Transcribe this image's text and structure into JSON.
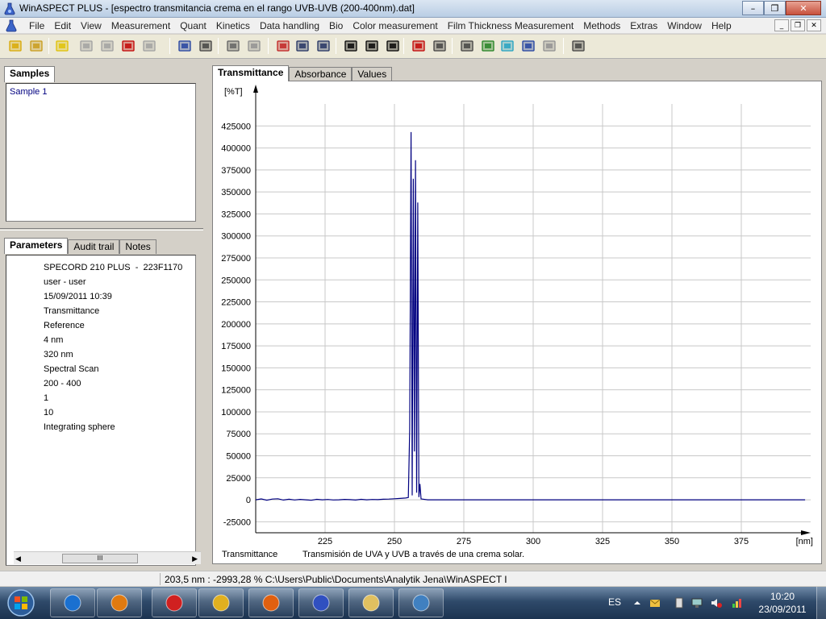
{
  "window": {
    "title": "WinASPECT PLUS - [espectro transmitancia crema en el rango UVB-UVB (200-400nm).dat]",
    "minimize": "–",
    "maximize": "❐",
    "close": "✕"
  },
  "menu": [
    "File",
    "Edit",
    "View",
    "Measurement",
    "Quant",
    "Kinetics",
    "Data handling",
    "Bio",
    "Color measurement",
    "Film Thickness Measurement",
    "Methods",
    "Extras",
    "Window",
    "Help"
  ],
  "mdi_buttons": [
    "_",
    "❐",
    "✕"
  ],
  "toolbar": [
    {
      "name": "open-icon",
      "color": "#d8a800"
    },
    {
      "name": "database-icon",
      "color": "#c89a18"
    },
    {
      "name": "palette-icon",
      "color": "#e0c000"
    },
    {
      "name": "camera-icon",
      "color": "#a0a0a0"
    },
    {
      "name": "camera-settings-icon",
      "color": "#a0a0a0"
    },
    {
      "name": "record-icon",
      "color": "#c00000"
    },
    {
      "name": "refresh-disabled-icon",
      "color": "#a0a0a0"
    },
    {
      "name": "save-icon",
      "color": "#1f3f9f"
    },
    {
      "name": "print-icon",
      "color": "#404040"
    },
    {
      "name": "copy-icon",
      "color": "#606060"
    },
    {
      "name": "paste-icon",
      "color": "#909090"
    },
    {
      "name": "graph-icon",
      "color": "#c02020"
    },
    {
      "name": "zoom-in-icon",
      "color": "#203060"
    },
    {
      "name": "zoom-out-icon",
      "color": "#203060"
    },
    {
      "name": "grid-icon",
      "color": "#000000"
    },
    {
      "name": "horizontal-grid-icon",
      "color": "#000000"
    },
    {
      "name": "vertical-grid-icon",
      "color": "#000000"
    },
    {
      "name": "cursor-icon",
      "color": "#c00000"
    },
    {
      "name": "rotate-icon",
      "color": "#404040"
    },
    {
      "name": "report-icon",
      "color": "#404040"
    },
    {
      "name": "export-image-icon",
      "color": "#208020"
    },
    {
      "name": "text-tool-icon",
      "color": "#20a0c0"
    },
    {
      "name": "cut-icon",
      "color": "#1f3f9f"
    },
    {
      "name": "scissors-disabled-icon",
      "color": "#909090"
    },
    {
      "name": "table-icon",
      "color": "#404040"
    }
  ],
  "samples": {
    "tab": "Samples",
    "items": [
      "Sample 1"
    ]
  },
  "params_tabs": [
    "Parameters",
    "Audit trail",
    "Notes"
  ],
  "parameters": [
    "SPECORD 210 PLUS  -  223F1170",
    "user - user",
    "15/09/2011 10:39",
    "Transmittance",
    "Reference",
    "4 nm",
    "320 nm",
    "Spectral Scan",
    "200 - 400",
    "1",
    "10",
    "Integrating sphere"
  ],
  "scrollbar_thumb": "III",
  "chart_tabs": [
    "Transmittance",
    "Absorbance",
    "Values"
  ],
  "chart_data": {
    "type": "line",
    "ylabel": "[%T]",
    "xlabel": "[nm]",
    "footer_left": "Transmittance",
    "footer_caption": "Transmisión de UVA y UVB a través de una crema solar.",
    "xlim": [
      200,
      400
    ],
    "ylim": [
      -37500,
      450000
    ],
    "x_ticks": [
      225,
      250,
      275,
      300,
      325,
      350,
      375
    ],
    "y_ticks": [
      -25000,
      0,
      25000,
      50000,
      75000,
      100000,
      125000,
      150000,
      175000,
      200000,
      225000,
      250000,
      275000,
      300000,
      325000,
      350000,
      375000,
      400000,
      425000
    ],
    "grid": true,
    "line_color": "#000080",
    "series": [
      {
        "x": [
          200,
          202,
          204,
          206,
          208,
          210,
          212,
          214,
          216,
          218,
          220,
          222,
          224,
          226,
          228,
          230,
          232,
          234,
          236,
          238,
          240,
          242,
          244,
          246,
          248,
          250,
          252,
          254,
          255,
          255.5,
          256,
          256.4,
          256.8,
          257.2,
          257.6,
          258,
          258.4,
          258.8,
          259.2,
          259.6,
          260,
          262,
          265,
          270,
          280,
          300,
          320,
          340,
          360,
          380,
          398
        ],
        "y": [
          0,
          1000,
          -500,
          800,
          1200,
          -300,
          600,
          -200,
          400,
          0,
          -600,
          500,
          0,
          300,
          -200,
          0,
          400,
          200,
          -300,
          500,
          0,
          300,
          200,
          600,
          800,
          1200,
          1500,
          2000,
          2500,
          80000,
          418000,
          5000,
          365000,
          55000,
          386000,
          8000,
          338000,
          3000,
          18000,
          1000,
          800,
          0,
          0,
          0,
          0,
          0,
          0,
          0,
          0,
          0,
          0
        ]
      }
    ]
  },
  "status": {
    "text": "203,5 nm : -2993,28  % C:\\Users\\Public\\Documents\\Analytik Jena\\WinASPECT I"
  },
  "taskbar": {
    "apps": [
      {
        "name": "ie-icon",
        "color": "#1a70d0"
      },
      {
        "name": "media-player-icon",
        "color": "#e07a10"
      },
      {
        "name": "pin-icon",
        "color": "#d02020"
      },
      {
        "name": "mail-icon",
        "color": "#e0b020"
      },
      {
        "name": "firefox-icon",
        "color": "#e06010"
      },
      {
        "name": "winaspect-icon",
        "color": "#3050c0"
      },
      {
        "name": "folder-icon",
        "color": "#e0c060"
      },
      {
        "name": "picture-icon",
        "color": "#4080c0"
      }
    ],
    "language": "ES",
    "time": "10:20",
    "date": "23/09/2011"
  }
}
